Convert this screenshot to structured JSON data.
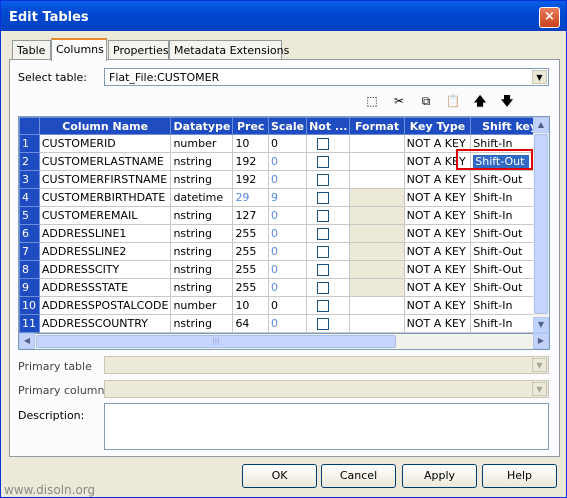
{
  "window": {
    "title": "Edit Tables",
    "close": "×"
  },
  "tabs": [
    "Table",
    "Columns",
    "Properties",
    "Metadata Extensions"
  ],
  "select_table": {
    "label": "Select table:",
    "value": "Flat_File:CUSTOMER"
  },
  "toolbar": {
    "new": "⬚",
    "cut": "✂",
    "copy": "⧉",
    "paste": "📋",
    "up": "🡅",
    "down": "🡇"
  },
  "grid": {
    "headers": [
      "Column Name",
      "Datatype",
      "Prec",
      "Scale",
      "Not ...",
      "Format",
      "Key Type",
      "Shift key"
    ],
    "rows": [
      {
        "n": "1",
        "name": "CUSTOMERID",
        "type": "number",
        "prec": "10",
        "scale": "0",
        "key": "NOT A KEY",
        "shift": "Shift-In"
      },
      {
        "n": "2",
        "name": "CUSTOMERLASTNAME",
        "type": "nstring",
        "prec": "192",
        "scale": "0",
        "key": "NOT A KEY",
        "shift": "Shift-Out"
      },
      {
        "n": "3",
        "name": "CUSTOMERFIRSTNAME",
        "type": "nstring",
        "prec": "192",
        "scale": "0",
        "key": "NOT A KEY",
        "shift": "Shift-Out"
      },
      {
        "n": "4",
        "name": "CUSTOMERBIRTHDATE",
        "type": "datetime",
        "prec": "29",
        "scale": "9",
        "key": "NOT A KEY",
        "shift": "Shift-In"
      },
      {
        "n": "5",
        "name": "CUSTOMEREMAIL",
        "type": "nstring",
        "prec": "127",
        "scale": "0",
        "key": "NOT A KEY",
        "shift": "Shift-In"
      },
      {
        "n": "6",
        "name": "ADDRESSLINE1",
        "type": "nstring",
        "prec": "255",
        "scale": "0",
        "key": "NOT A KEY",
        "shift": "Shift-Out"
      },
      {
        "n": "7",
        "name": "ADDRESSLINE2",
        "type": "nstring",
        "prec": "255",
        "scale": "0",
        "key": "NOT A KEY",
        "shift": "Shift-Out"
      },
      {
        "n": "8",
        "name": "ADDRESSCITY",
        "type": "nstring",
        "prec": "255",
        "scale": "0",
        "key": "NOT A KEY",
        "shift": "Shift-Out"
      },
      {
        "n": "9",
        "name": "ADDRESSSTATE",
        "type": "nstring",
        "prec": "255",
        "scale": "0",
        "key": "NOT A KEY",
        "shift": "Shift-Out"
      },
      {
        "n": "10",
        "name": "ADDRESSPOSTALCODE",
        "type": "number",
        "prec": "10",
        "scale": "0",
        "key": "NOT A KEY",
        "shift": "Shift-In"
      },
      {
        "n": "11",
        "name": "ADDRESSCOUNTRY",
        "type": "nstring",
        "prec": "64",
        "scale": "0",
        "key": "NOT A KEY",
        "shift": "Shift-In"
      }
    ],
    "scroll_grip": "|||"
  },
  "primary_table": {
    "label": "Primary table"
  },
  "primary_column": {
    "label": "Primary column:"
  },
  "description": {
    "label": "Description:"
  },
  "buttons": {
    "ok": "OK",
    "cancel": "Cancel",
    "apply": "Apply",
    "help": "Help"
  },
  "watermark": "www.disoln.org"
}
